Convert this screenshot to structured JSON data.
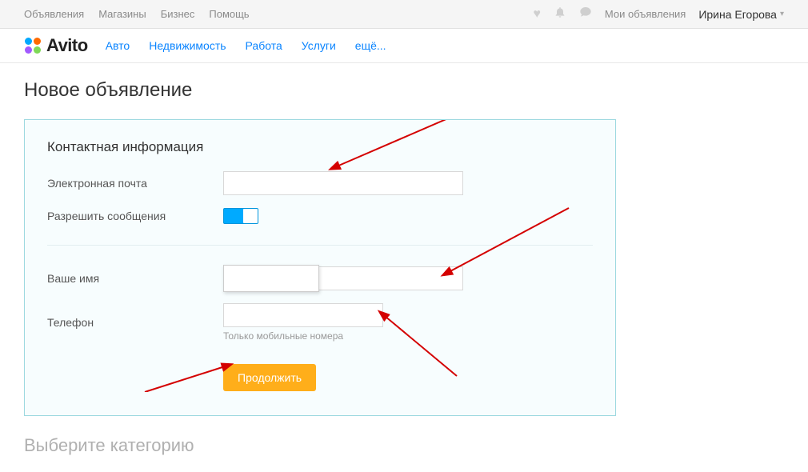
{
  "topbar": {
    "links": [
      "Объявления",
      "Магазины",
      "Бизнес",
      "Помощь"
    ],
    "my_ads": "Мои объявления",
    "user_name": "Ирина Егорова"
  },
  "logo_text": "Avito",
  "categories": [
    "Авто",
    "Недвижимость",
    "Работа",
    "Услуги",
    "ещё..."
  ],
  "page_title": "Новое объявление",
  "form": {
    "section_title": "Контактная информация",
    "email_label": "Электронная почта",
    "email_value": "",
    "messages_label": "Разрешить сообщения",
    "name_label": "Ваше имя",
    "name_value": "",
    "phone_label": "Телефон",
    "phone_value": "",
    "phone_hint": "Только мобильные номера",
    "continue_label": "Продолжить"
  },
  "section2_title": "Выберите категорию"
}
